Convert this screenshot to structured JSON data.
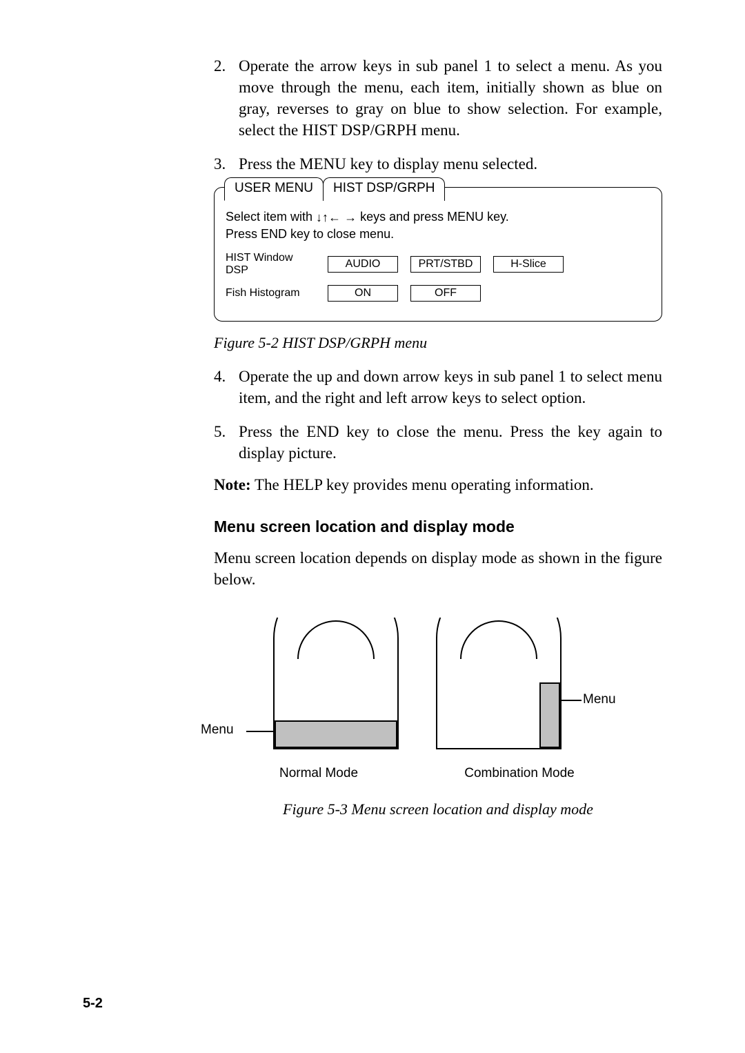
{
  "steps": {
    "s2": {
      "num": "2.",
      "text": "Operate the arrow keys in sub panel 1 to select a menu. As you move through the menu, each item, initially shown as blue on gray, reverses to gray on blue to show selection. For example, select the HIST DSP/GRPH menu."
    },
    "s3": {
      "num": "3.",
      "text": "Press the MENU key to display menu selected."
    },
    "s4": {
      "num": "4.",
      "text": "Operate the up and down arrow keys in sub panel 1 to select menu item, and the right and left arrow keys to select option."
    },
    "s5": {
      "num": "5.",
      "text": "Press the END key to close the menu. Press the key again to display picture."
    }
  },
  "menu": {
    "tab1": "USER MENU",
    "tab2": "HIST DSP/GRPH",
    "instr_pre": "Select item with ",
    "instr_post": " keys and press MENU key.",
    "instr_line2": "Press END key to close menu.",
    "row1": {
      "label": "HIST Window DSP",
      "opt1": "AUDIO",
      "opt2": "PRT/STBD",
      "opt3": "H-Slice"
    },
    "row2": {
      "label": "Fish Histogram",
      "opt1": "ON",
      "opt2": "OFF"
    }
  },
  "fig52_caption": "Figure 5-2 HIST DSP/GRPH menu",
  "note_label": "Note:",
  "note_text": " The HELP key provides menu operating information.",
  "section_title": "Menu screen location and display mode",
  "section_para": "Menu screen location depends on display mode as shown in the figure below.",
  "fig53": {
    "left_label": "Menu",
    "right_label": "Menu",
    "normal": "Normal Mode",
    "combo": "Combination Mode"
  },
  "fig53_caption": "Figure 5-3 Menu screen location and display mode",
  "page_number": "5-2"
}
